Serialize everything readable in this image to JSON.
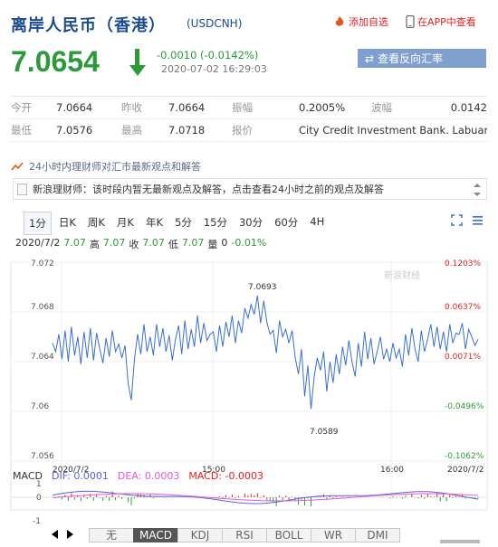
{
  "header": {
    "title": "离岸人民币（香港）",
    "code": "(USDCNH)",
    "add_favorite": "添加自选",
    "open_app": "在APP中查看"
  },
  "quote": {
    "price": "7.0654",
    "change": "-0.0010 (-0.0142%)",
    "time": "2020-07-02 16:29:03",
    "reverse_button": "查看反向汇率"
  },
  "stats": {
    "row1": [
      {
        "label": "今开",
        "value": "7.0664"
      },
      {
        "label": "昨收",
        "value": "7.0664"
      },
      {
        "label": "振幅",
        "value": "0.2005%"
      },
      {
        "label": "波幅",
        "value": "0.0142"
      }
    ],
    "row2": [
      {
        "label": "最低",
        "value": "7.0576"
      },
      {
        "label": "最高",
        "value": "7.0718"
      },
      {
        "label": "报价",
        "value": "City Credit Investment Bank. Labuan"
      }
    ]
  },
  "news": {
    "headline": "24小时内理财师对汇市最新观点和解答",
    "ticker": "新浪理财师：该时段内暂无最新观点及解答，点击查看24小时之前的观点及解答"
  },
  "tabs": [
    "1分",
    "日K",
    "周K",
    "月K",
    "年K",
    "5分",
    "15分",
    "30分",
    "60分",
    "4H"
  ],
  "active_tab": "1分",
  "ohlc": {
    "date": "2020/7/2",
    "open": "7.07",
    "high_label": "高",
    "high": "7.07",
    "close_label": "收",
    "close": "7.07",
    "low_label": "低",
    "low": "7.07",
    "vol_label": "量",
    "vol": "0",
    "pct": "-0.01%"
  },
  "chart_data": {
    "type": "line",
    "y_ticks": [
      "7.072",
      "7.068",
      "7.064",
      "7.06",
      "7.056"
    ],
    "ylim": [
      7.056,
      7.072
    ],
    "pct_ticks": [
      "0.1203%",
      "0.0637%",
      "0.0071%",
      "-0.0496%",
      "-0.1062%"
    ],
    "x_ticks": [
      "2020/7/2",
      "15:00",
      "16:00",
      "2020/7/2"
    ],
    "annotations": [
      "7.0693",
      "7.0589"
    ],
    "watermark": "新浪财经",
    "values": [
      7.0655,
      7.0648,
      7.0662,
      7.0642,
      7.0665,
      7.064,
      7.0668,
      7.0645,
      7.066,
      7.0638,
      7.0664,
      7.0643,
      7.0667,
      7.0641,
      7.0663,
      7.065,
      7.0639,
      7.0659,
      7.0644,
      7.0665,
      7.0648,
      7.0654,
      7.0643,
      7.0653,
      7.0622,
      7.0609,
      7.0642,
      7.0662,
      7.0646,
      7.067,
      7.0648,
      7.066,
      7.0645,
      7.067,
      7.0652,
      7.0667,
      7.0648,
      7.0661,
      7.0641,
      7.0658,
      7.0669,
      7.0646,
      7.0673,
      7.065,
      7.0666,
      7.0652,
      7.0677,
      7.0655,
      7.0671,
      7.0657,
      7.0662,
      7.0664,
      7.0648,
      7.0669,
      7.0652,
      7.0672,
      7.066,
      7.0677,
      7.0655,
      7.0673,
      7.0663,
      7.0683,
      7.0675,
      7.0686,
      7.0678,
      7.0693,
      7.0671,
      7.0689,
      7.0672,
      7.0662,
      7.0665,
      7.0647,
      7.0673,
      7.066,
      7.0666,
      7.0655,
      7.0665,
      7.0643,
      7.063,
      7.065,
      7.0612,
      7.0637,
      7.0602,
      7.0628,
      7.0643,
      7.0633,
      7.0648,
      7.0616,
      7.064,
      7.0623,
      7.0646,
      7.063,
      7.0652,
      7.0637,
      7.0657,
      7.064,
      7.0628,
      7.0655,
      7.0636,
      7.0664,
      7.0642,
      7.0659,
      7.0638,
      7.0648,
      7.066,
      7.0642,
      7.065,
      7.064,
      7.0655,
      7.0643,
      7.065,
      7.0636,
      7.0662,
      7.0645,
      7.0667,
      7.065,
      7.064,
      7.0665,
      7.0648,
      7.0658,
      7.067,
      7.0652,
      7.0668,
      7.065,
      7.0664,
      7.0648,
      7.067,
      7.0655,
      7.0663,
      7.0662,
      7.0671,
      7.065,
      7.0666,
      7.066,
      7.0653,
      7.0658
    ]
  },
  "macd": {
    "label": "MACD",
    "dif": "DIF: 0.0001",
    "dea": "DEA: 0.0003",
    "macd": "MACD: -0.0003",
    "y_ticks": [
      "1",
      "0",
      "-1"
    ]
  },
  "bottom_tabs": [
    "无",
    "MACD",
    "KDJ",
    "RSI",
    "BOLL",
    "WR",
    "DMI"
  ],
  "colors": {
    "up": "#e02222",
    "down": "#2c9a3a",
    "line": "#3a6fd1",
    "dif": "#5a62d9",
    "dea": "#e35ad8"
  }
}
